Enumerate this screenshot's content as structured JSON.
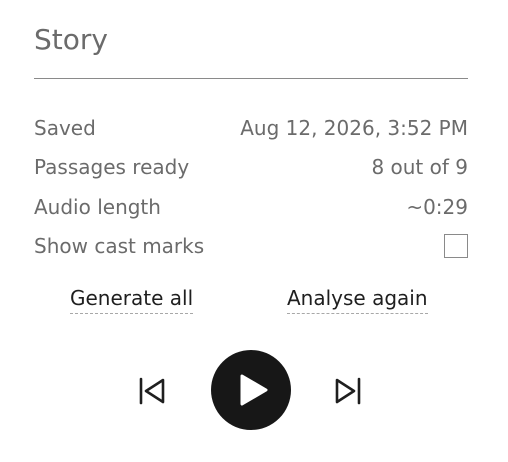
{
  "panel": {
    "title": "Story"
  },
  "details": {
    "saved_label": "Saved",
    "saved_value": "Aug 12, 2026, 3:52 PM",
    "passages_label": "Passages ready",
    "passages_value": "8 out of 9",
    "audio_label": "Audio length",
    "audio_value": "~0:29",
    "cast_marks_label": "Show cast marks",
    "cast_marks_checked": false
  },
  "actions": {
    "generate_label": "Generate all",
    "analyse_label": "Analyse again"
  },
  "player": {
    "prev_icon": "skip-previous-icon",
    "play_icon": "play-icon",
    "next_icon": "skip-next-icon",
    "play_button_color": "#171717"
  }
}
